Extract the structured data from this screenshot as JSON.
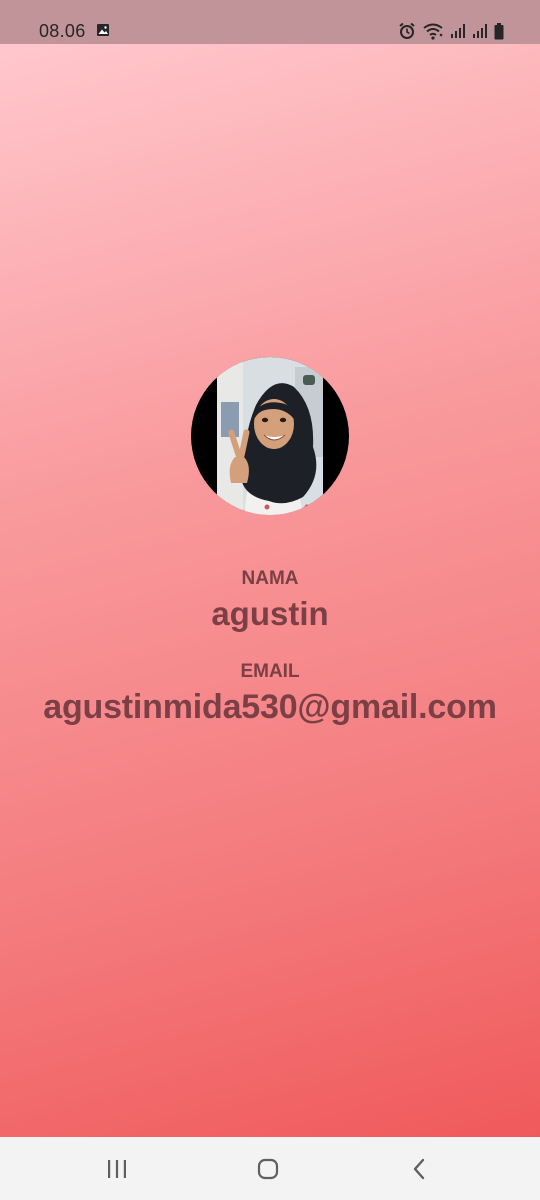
{
  "status_bar": {
    "time": "08.06",
    "icons": [
      "gallery-icon",
      "alarm-icon",
      "wifi-icon",
      "signal-icon",
      "signal-icon",
      "battery-icon"
    ]
  },
  "profile": {
    "avatar": "profile-photo",
    "name_label": "NAMA",
    "name": "agustin",
    "email_label": "EMAIL",
    "email": "agustinmida530@gmail.com"
  },
  "colors": {
    "status_bar": "#c19499",
    "gradient_top": "#ffc7cd",
    "gradient_bottom": "#f05a5c",
    "text": "#7b3f45",
    "nav_bar": "#f3f3f3"
  },
  "nav_bar": {
    "icons": [
      "recents-icon",
      "home-icon",
      "back-icon"
    ]
  }
}
